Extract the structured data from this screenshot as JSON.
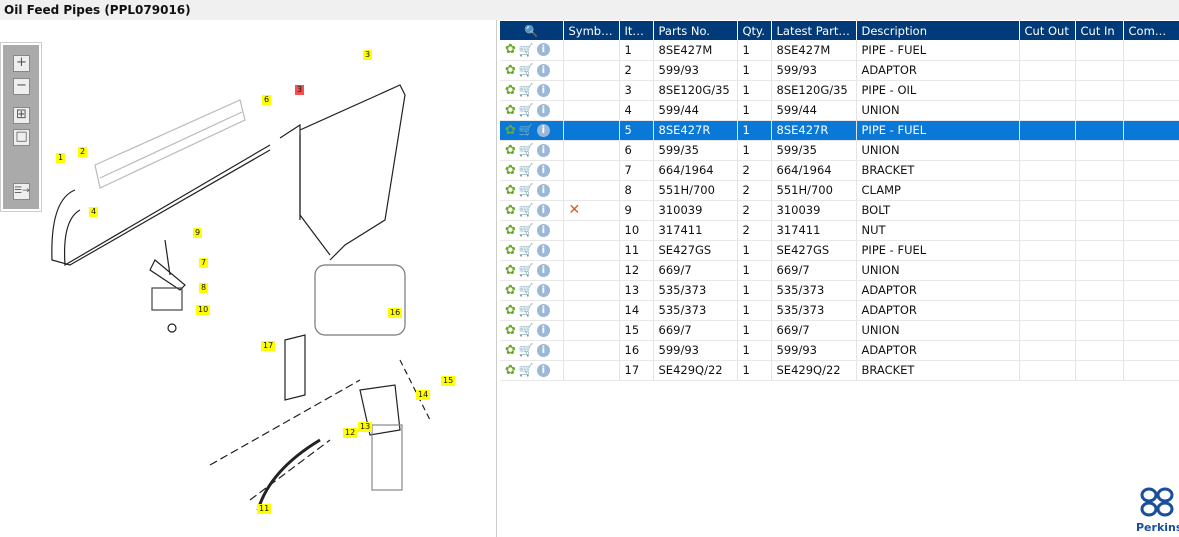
{
  "title": "Oil Feed Pipes (PPL079016)",
  "toolbar": {
    "zoom_in": "+",
    "zoom_out": "−",
    "fit": "⊞",
    "actual": "□",
    "panel": "☰→"
  },
  "callouts": [
    "1",
    "2",
    "3",
    "3",
    "4",
    "6",
    "9",
    "7",
    "8",
    "10",
    "17",
    "16",
    "15",
    "14",
    "13",
    "12",
    "11"
  ],
  "columns": [
    "Symbol...",
    "Item",
    "Parts No.",
    "Qty.",
    "Latest Part No.",
    "Description",
    "Cut Out",
    "Cut In",
    "Comment"
  ],
  "rows": [
    {
      "sym": "",
      "item": "1",
      "part": "8SE427M",
      "qty": "1",
      "latest": "8SE427M",
      "desc": "PIPE - FUEL"
    },
    {
      "sym": "",
      "item": "2",
      "part": "599/93",
      "qty": "1",
      "latest": "599/93",
      "desc": "ADAPTOR"
    },
    {
      "sym": "",
      "item": "3",
      "part": "8SE120G/35",
      "qty": "1",
      "latest": "8SE120G/35",
      "desc": "PIPE - OIL"
    },
    {
      "sym": "",
      "item": "4",
      "part": "599/44",
      "qty": "1",
      "latest": "599/44",
      "desc": "UNION"
    },
    {
      "sym": "",
      "item": "5",
      "part": "8SE427R",
      "qty": "1",
      "latest": "8SE427R",
      "desc": "PIPE - FUEL"
    },
    {
      "sym": "",
      "item": "6",
      "part": "599/35",
      "qty": "1",
      "latest": "599/35",
      "desc": "UNION"
    },
    {
      "sym": "",
      "item": "7",
      "part": "664/1964",
      "qty": "2",
      "latest": "664/1964",
      "desc": "BRACKET"
    },
    {
      "sym": "",
      "item": "8",
      "part": "551H/700",
      "qty": "2",
      "latest": "551H/700",
      "desc": "CLAMP"
    },
    {
      "sym": "✕",
      "item": "9",
      "part": "310039",
      "qty": "2",
      "latest": "310039",
      "desc": "BOLT"
    },
    {
      "sym": "",
      "item": "10",
      "part": "317411",
      "qty": "2",
      "latest": "317411",
      "desc": "NUT"
    },
    {
      "sym": "",
      "item": "11",
      "part": "SE427GS",
      "qty": "1",
      "latest": "SE427GS",
      "desc": "PIPE - FUEL"
    },
    {
      "sym": "",
      "item": "12",
      "part": "669/7",
      "qty": "1",
      "latest": "669/7",
      "desc": "UNION"
    },
    {
      "sym": "",
      "item": "13",
      "part": "535/373",
      "qty": "1",
      "latest": "535/373",
      "desc": "ADAPTOR"
    },
    {
      "sym": "",
      "item": "14",
      "part": "535/373",
      "qty": "1",
      "latest": "535/373",
      "desc": "ADAPTOR"
    },
    {
      "sym": "",
      "item": "15",
      "part": "669/7",
      "qty": "1",
      "latest": "669/7",
      "desc": "UNION"
    },
    {
      "sym": "",
      "item": "16",
      "part": "599/93",
      "qty": "1",
      "latest": "599/93",
      "desc": "ADAPTOR"
    },
    {
      "sym": "",
      "item": "17",
      "part": "SE429Q/22",
      "qty": "1",
      "latest": "SE429Q/22",
      "desc": "BRACKET"
    }
  ],
  "selected_item": "5",
  "logo": "Perkins"
}
